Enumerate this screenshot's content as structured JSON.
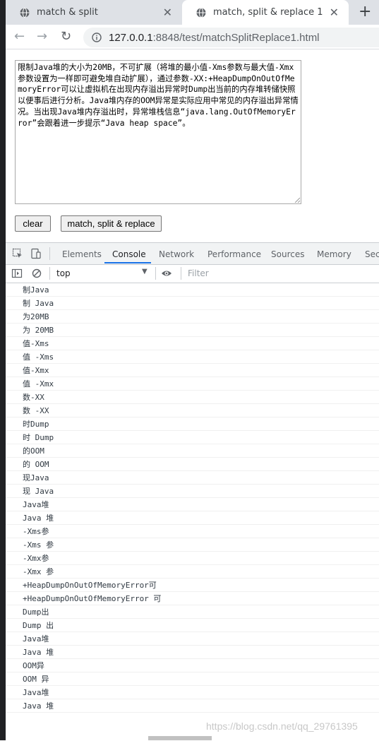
{
  "browser": {
    "tabs": [
      {
        "title": "match & split",
        "active": false
      },
      {
        "title": "match, split & replace 1",
        "active": true
      }
    ],
    "new_tab": "+",
    "url_host": "127.0.0.1",
    "url_rest": ":8848/test/matchSplitReplace1.html"
  },
  "page": {
    "textarea_value": "限制Java堆的大小为20MB，不可扩展（将堆的最小值-Xms参数与最大值-Xmx参数设置为一样即可避免堆自动扩展），通过参数-XX:+HeapDumpOnOutOfMemoryError可以让虚拟机在出现内存溢出异常时Dump出当前的内存堆转储快照以便事后进行分析。Java堆内存的OOM异常是实际应用中常见的内存溢出异常情况。当出现Java堆内存溢出时，异常堆栈信息“java.lang.OutOfMemoryError”会跟着进一步提示“Java heap space”。",
    "clear_label": "clear",
    "msr_label": "match, split & replace"
  },
  "devtools": {
    "tabs": [
      "Elements",
      "Console",
      "Network",
      "Performance",
      "Sources",
      "Memory",
      "Secu"
    ],
    "active_tab": "Console",
    "context": "top",
    "filter_placeholder": "Filter"
  },
  "console_lines": [
    "制Java",
    "制 Java",
    "为20MB",
    "为 20MB",
    "值-Xms",
    "值 -Xms",
    "值-Xmx",
    "值 -Xmx",
    "数-XX",
    "数 -XX",
    "时Dump",
    "时 Dump",
    "的OOM",
    "的 OOM",
    "现Java",
    "现 Java",
    "Java堆",
    "Java 堆",
    "-Xms参",
    "-Xms 参",
    "-Xmx参",
    "-Xmx 参",
    "+HeapDumpOnOutOfMemoryError可",
    "+HeapDumpOnOutOfMemoryError 可",
    "Dump出",
    "Dump 出",
    "Java堆",
    "Java 堆",
    "OOM异",
    "OOM 异",
    "Java堆",
    "Java 堆"
  ],
  "watermark": "https://blog.csdn.net/qq_29761395",
  "colors": {
    "accent": "#1a73e8",
    "tabstrip": "#dee1e6"
  }
}
